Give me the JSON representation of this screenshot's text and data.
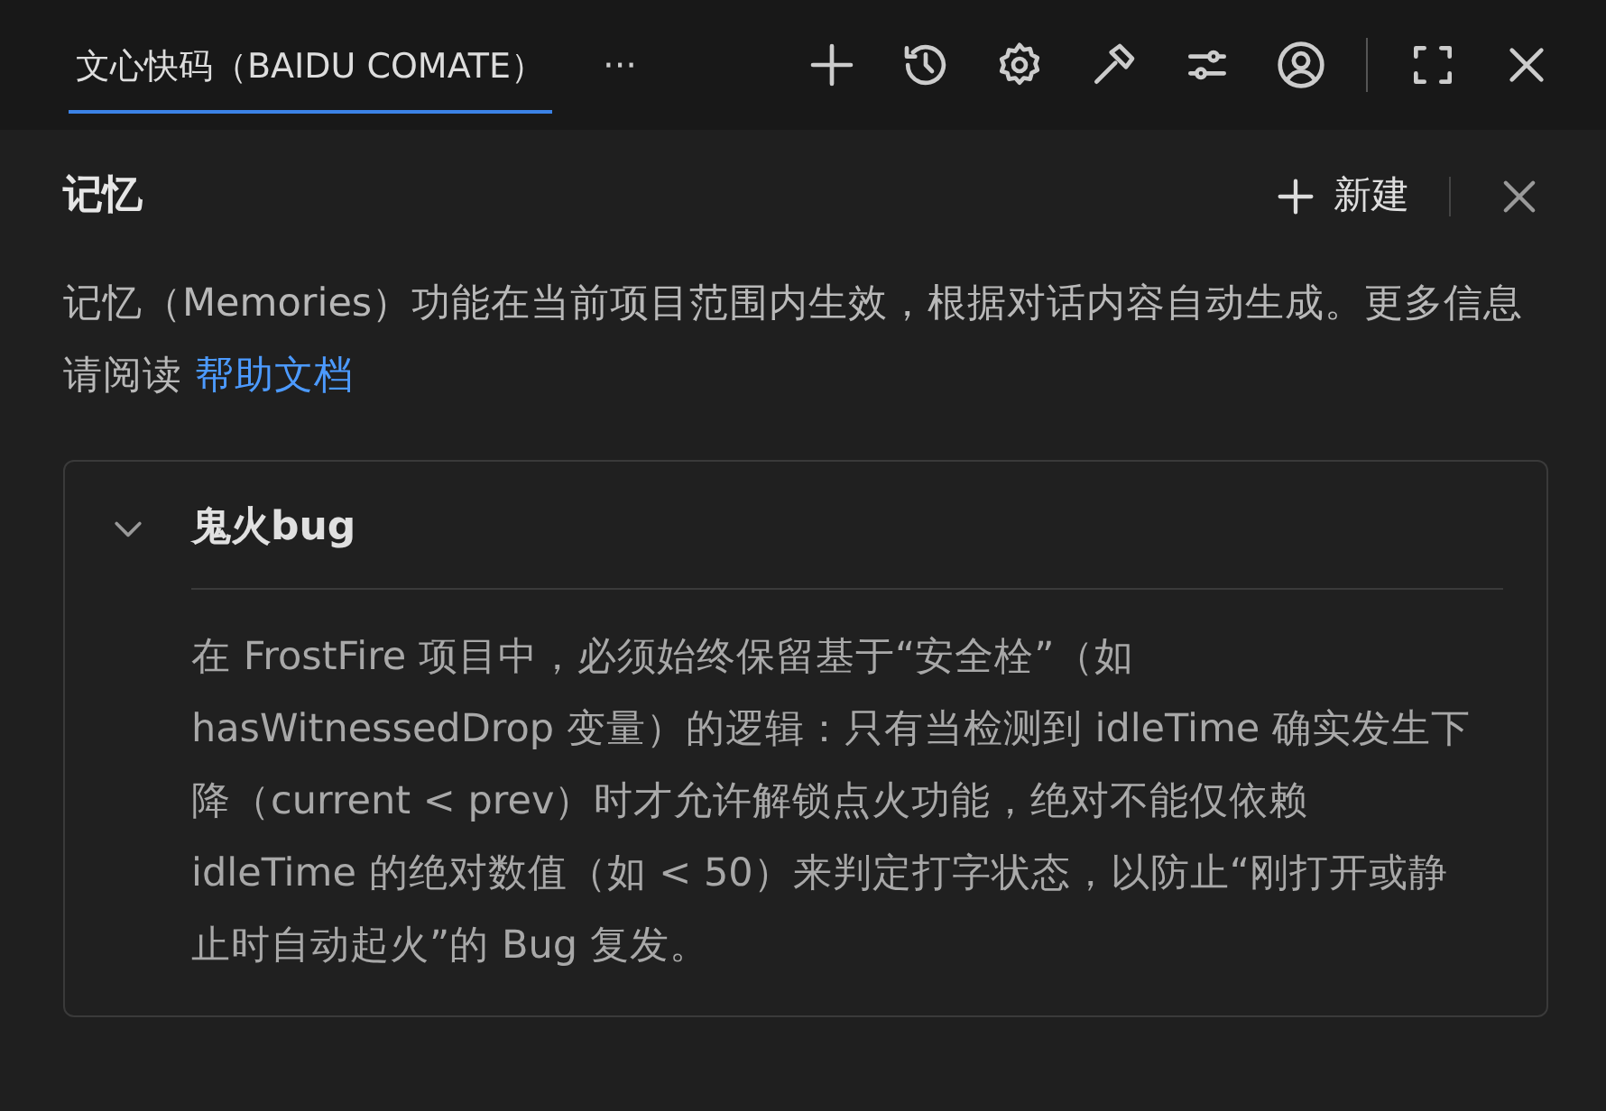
{
  "tab": {
    "label": "文心快码（BAIDU COMATE）",
    "selected": true
  },
  "more": "···",
  "panel": {
    "title": "记忆",
    "new_button": "新建",
    "description": "记忆（Memories）功能在当前项目范围内生效，根据对话内容自动生成。更多信息请阅读",
    "help_link": "帮助文档"
  },
  "memories": [
    {
      "title": "鬼火bug",
      "expanded": true,
      "body": "在 FrostFire 项目中，必须始终保留基于“安全栓”（如 hasWitnessedDrop 变量）的逻辑：只有当检测到 idleTime 确实发生下降（current < prev）时才允许解锁点火功能，绝对不能仅依赖 idleTime 的绝对数值（如 < 50）来判定打字状态，以防止“刚打开或静止时自动起火”的 Bug 复发。"
    }
  ]
}
